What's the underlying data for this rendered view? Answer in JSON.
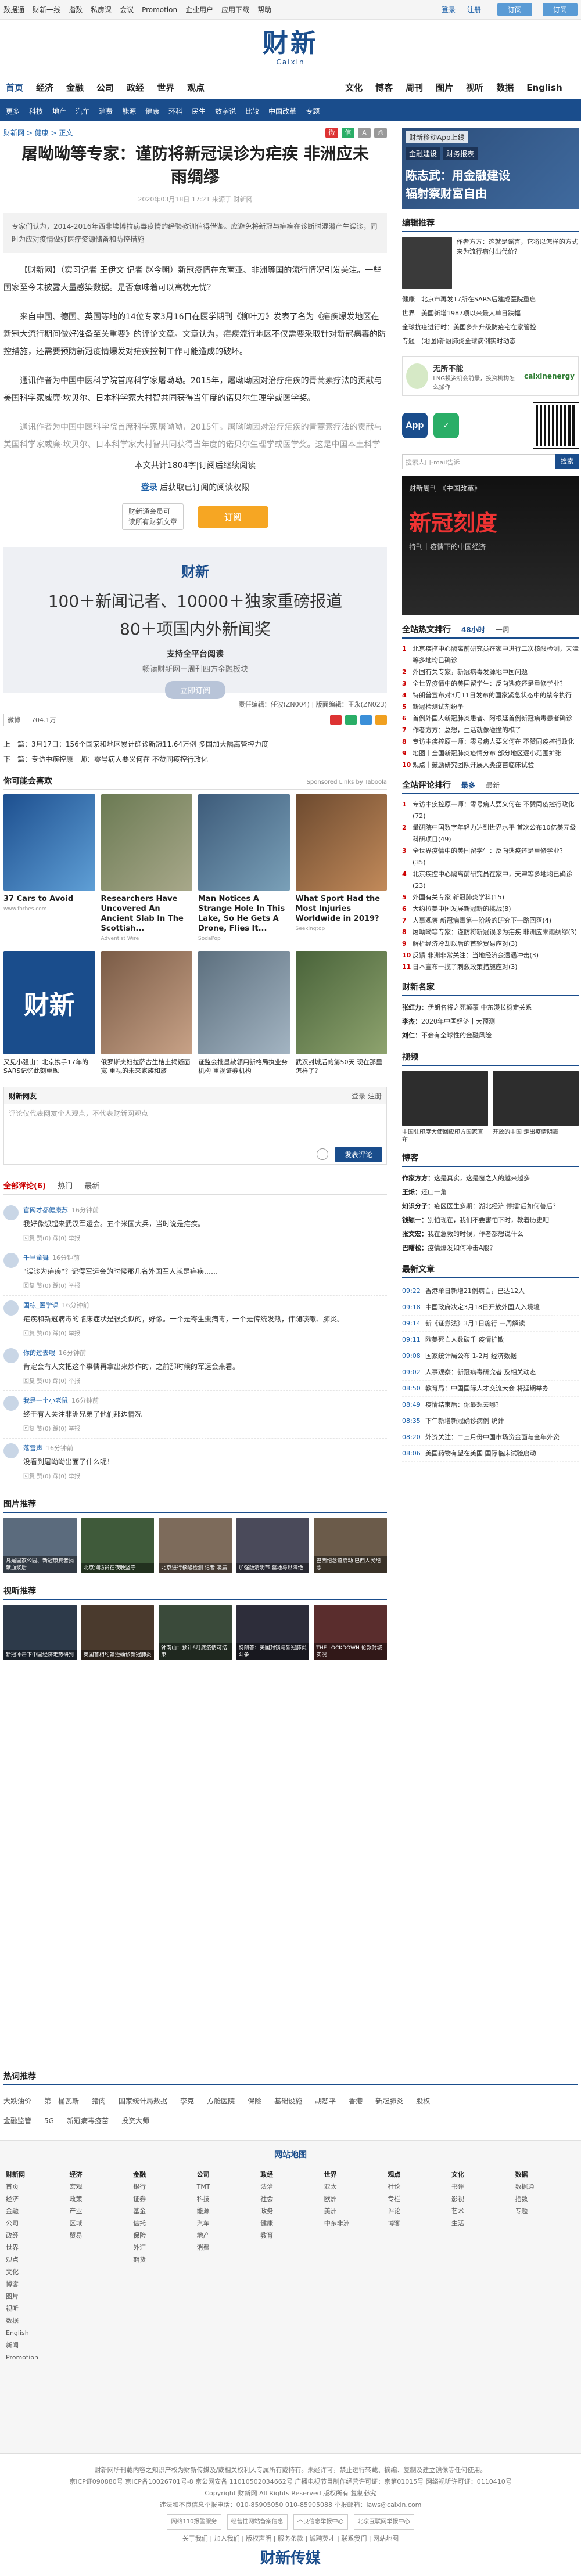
{
  "topbar": {
    "links": [
      "数据通",
      "财新一线",
      "指数",
      "私房课",
      "会议",
      "Promotion",
      "企业用户",
      "应用下载",
      "帮助"
    ],
    "login": "登录",
    "register": "注册",
    "sub_btn": "订阅",
    "sub_btn2": "订阅"
  },
  "header": {
    "logo": "财新",
    "logo_sub": "Caixin"
  },
  "mainnav": {
    "left": [
      "首页",
      "经济",
      "金融",
      "公司",
      "政经",
      "世界",
      "观点"
    ],
    "right": [
      "文化",
      "博客",
      "周刊",
      "图片",
      "视听",
      "数据",
      "English"
    ]
  },
  "subnav": {
    "items": [
      "更多",
      "科技",
      "地产",
      "汽车",
      "消费",
      "能源",
      "健康",
      "环科",
      "民生",
      "数字说",
      "比较",
      "中国改革",
      "专题"
    ],
    "more": "更多"
  },
  "article": {
    "breadcrumb": "财新网 > 健康 > 正文",
    "title": "屠呦呦等专家：谨防将新冠误诊为疟疾 非洲应未雨绸缪",
    "date": "2020年03月18日 17:21 来源于 财新网",
    "summary": "专家们认为，2014-2016年西非埃博拉病毒疫情的经验教训值得借鉴。应避免将新冠与疟疾在诊断时混淆产生误诊，同时为应对疫情做好医疗资源储备和防控措施",
    "p1": "【财新网】（实习记者 王伊文 记者 赵今朝）新冠疫情在东南亚、非洲等国的流行情况引发关注。一些国家至今未披露大量感染数据。是否意味着可以高枕无忧？",
    "p2": "来自中国、德国、英国等地的14位专家3月16日在医学期刊《柳叶刀》发表了名为《疟疾爆发地区在新冠大流行期间做好准备至关重要》的评论文章。文章认为，疟疾流行地区不仅需要采取针对新冠病毒的防控措施，还需要预防新冠疫情爆发对疟疾控制工作可能造成的破坏。",
    "p3": "通讯作者为中国中医科学院首席科学家屠呦呦。2015年，屠呦呦因对治疗疟疾的青蒿素疗法的贡献与美国科学家威廉·坎贝尔、日本科学家大村智共同获得当年度的诺贝尔生理学或医学奖。",
    "p4": "通讯作者为中国中医科学院首席科学家屠呦呦，2015年。屠呦呦因对治疗疟疾的青蒿素疗法的贡献与美国科学家威廉·坎贝尔、日本科学家大村智共同获得当年度的诺贝尔生理学或医学奖。这是中国本土科学家首次获得诺贝尔科学奖。",
    "wordcount": "本文共计1804字|订阅后继续阅读",
    "login_read_a": "登录",
    "login_read_b": " 后获取已订阅的阅读权限",
    "sub_note_1": "财新通会员可",
    "sub_note_2": "读所有财新文章",
    "sub_button": "订阅"
  },
  "promo": {
    "logo": "财新",
    "line1": "100＋新闻记者、10000＋独家重磅报道",
    "line2": "80＋项国内外新闻奖",
    "line3": "支持全平台阅读",
    "line4": "畅读财新网＋周刊四方金融板块",
    "line5": "立即订阅"
  },
  "meta": {
    "editors": "责任编辑：任波(ZN004) | 版面编辑：王永(ZN023)",
    "weibo": "微博",
    "weibo_count": "704.1万",
    "prev": "上一篇：3月17日：156个国家和地区累计确诊新冠11.64万例 多国加大隔离管控力度",
    "next": "下一篇：专访中疾控原一师：零号病人要义何在 不赞同疫控行政化"
  },
  "recommend": {
    "title": "你可能会喜欢",
    "sponsor": "Sponsored Links by Taboola",
    "row1": [
      {
        "cap": "37 Cars to Avoid",
        "src": "www.forbes.com"
      },
      {
        "cap": "Researchers Have Uncovered An Ancient Slab In The Scottish...",
        "src": "Adventist Wire"
      },
      {
        "cap": "Man Notices A Strange Hole In This Lake, So He Gets A Drone, Flies It...",
        "src": "SodaPop"
      },
      {
        "cap": "What Sport Had the Most Injuries Worldwide in 2019?",
        "src": "Seekingtop"
      }
    ],
    "row2": [
      {
        "cap": "又见小强山：北京携手17年的SARS记忆此刻重现"
      },
      {
        "cap": "俄罗斯夫妇拉萨古生桔土揭疑面宽 重视的未来家族和旅"
      },
      {
        "cap": "证监会批量赦领用新格局执业务机构 重视证券机构"
      },
      {
        "cap": "武汉封城后的第50天 现在那里怎样了？"
      }
    ]
  },
  "comments": {
    "box_title": "财新网友",
    "login": "登录  注册",
    "placeholder": "评论仅代表网友个人观点，不代表财新网观点",
    "submit": "发表评论",
    "tab_all": "全部评论(6)",
    "tab_hot": "热门",
    "tab_new": "最新",
    "items": [
      {
        "user": "官网才都健康苏",
        "time": "16分钟前",
        "text": "我好像想起来武汉军运会。五个米国大兵，当时说是疟疾。"
      },
      {
        "user": "千里童舞",
        "time": "16分钟前",
        "text": "\"误诊为疟疾\"？记得军运会的时候那几名外国军人就是疟疾……"
      },
      {
        "user": "国栋_医学课",
        "time": "16分钟前",
        "text": "疟疾和新冠病毒的临床症状是很类似的，好像。一个是寄生虫病毒，一个是传统发热，伴随咳嗽、肺炎。"
      },
      {
        "user": "你的过去喂",
        "time": "16分钟前",
        "text": "肯定会有人文把这个事情再拿出来炒作的，之前那时候的军运会来看。"
      },
      {
        "user": "我是一个小老鼠",
        "time": "16分钟前",
        "text": "终于有人关注非洲兄弟了他们那边情况"
      },
      {
        "user": "落雪声",
        "time": "16分钟前",
        "text": "没看到屠呦呦出面了什么呢！"
      }
    ],
    "ops": "回复  赞(0)  踩(0)  举报"
  },
  "pics": {
    "title": "图片推荐",
    "items": [
      "凡是国家公园、新冠康复者捐献血浆后",
      "北京消防员在夜晚坚守",
      "北京进行核酸检测 记者 凌晨",
      "加强版清明节 墓地与世隔绝",
      "巴西纪念馆启动 巴西人民纪念"
    ]
  },
  "videos": {
    "title": "视听推荐",
    "items": [
      "新冠冲击下中国经济走势研判",
      "英国首相约翰逊确诊新冠肺炎",
      "钟南山：预计6月底疫情可结束",
      "特朗普：美国封锁与新冠肺炎斗争",
      "THE LOCKDOWN 伦敦封城实况"
    ]
  },
  "side": {
    "ad1": {
      "label": "财新移动App上线",
      "tag1": "金融建设",
      "tag2": "财务报表",
      "h1": "陈志武：用金融建设",
      "h2": "辐射察财富自由"
    },
    "editor_title": "编辑推荐",
    "feature_txt": "作者方方：这就是谣言，它将以怎样的方式来为流行病付出代价？",
    "editor_list": [
      "健康｜北京市再发17所在SARS后建成医院重启",
      "世界｜美国新增1987项以来最大单日跌幅",
      "全球抗疫进行时：美国多州升级防疫宅在家管控",
      "专题｜(地图)新冠肺炎全球病例实时动态"
    ],
    "ad2": {
      "t1": "无所不能",
      "t2": "LNG投资机会前景，投资机构怎么操作",
      "brand": "caixinenergy"
    },
    "app_label": "App",
    "search_placeholder": "搜索人口-mail告诉",
    "search_btn": "搜索",
    "ad3": {
      "a1": "财新周刊 《中国改革》",
      "a2": "新冠刻度",
      "a3": "特刊｜疫情下的中国经济"
    },
    "rank": {
      "title": "全站热文排行",
      "tab1": "48小时",
      "tab2": "一周",
      "items": [
        "北京疾控中心隔离前研究员在家中进行二次核酸检测，天津等多地均已确诊",
        "外国有关专家，新冠病毒发源地中国问题",
        "全世界疫情中的美国留学生：反向逃疫还是重修学业？",
        "特朗普宣布对3月11日发布的国家紧急状态中的禁令执行",
        "新冠检测试剂纷争",
        "首例外国人新冠肺炎患者、阿根廷首例新冠病毒患者确诊",
        "作者方方：总想，生活就像碰撞的棋子",
        "专访中疾控原一师：零号病人要义何在 不赞同疫控行政化",
        "地图｜全国新冠肺炎疫情分布 部分地区逐小范围扩张",
        "观点｜鼓励研究团队开展人类疫苗临床试验"
      ]
    },
    "comment_rank": {
      "title": "全站评论排行",
      "tab1": "最多",
      "tab2": "最新",
      "items": [
        "专访中疾控原一师：零号病人要义何在 不赞同疫控行政化(72)",
        "量研院中国数字年轻力达到世界水平 首次公布10亿美元级科研项目(49)",
        "全世界疫情中的美国留学生：反向逃疫还是重修学业？(35)",
        "北京疾控中心隔离前研究员在家中，天津等多地均已确诊(23)",
        "外国有关专家 新冠肺炎学科(15)",
        "大约拉美中国发展新冠新的挑战(8)",
        "人事观察 新冠病毒第一阶段的研究下一路回落(4)",
        "屠呦呦等专家：谨防将新冠误诊为疟疾 非洲应未雨绸缪(3)",
        "解析经济冷却以后的首轮贸易应对(3)",
        "反馈 非洲非常关注：当地经济会遭遇冲击(3)",
        "日本宣布一揽子刺激政策措施应对(3)"
      ]
    },
    "authors": {
      "title": "财新名家",
      "items": [
        {
          "n": "张红力",
          "t": "伊朗名将之死颠覆 中东漫长稳定关系"
        },
        {
          "n": "李杰",
          "t": "2020年中国经济十大预测"
        },
        {
          "n": "刘仁",
          "t": "不会有全球性的金融风险"
        }
      ]
    },
    "video": {
      "title": "视频",
      "items": [
        "中国驻印度大使回应印方国家宣布",
        "开放的中国 走出疫情阴霾"
      ]
    },
    "blog": {
      "title": "博客",
      "items": [
        {
          "n": "作家方方：",
          "t": "这是真实，这是窗之人的越来越多"
        },
        {
          "n": "王烁：",
          "t": "还山一角"
        },
        {
          "n": "知识分子：",
          "t": "疫区医生多期：湖北经济'停摆'后如何善后？"
        },
        {
          "n": "钱颖一：",
          "t": "别怕现在，我们不要害怕下时，教着历史吧"
        },
        {
          "n": "张文宏：",
          "t": "我在急救的时候，作者都想说什么"
        },
        {
          "n": "巴曙松：",
          "t": "疫情爆发如何冲击A股？"
        }
      ]
    },
    "latest": {
      "title": "最新文章",
      "items": [
        {
          "tm": "09:22",
          "t": "香港单日新增21例病亡，已达12人"
        },
        {
          "tm": "09:18",
          "t": "中国政府决定3月18日开放外国人入境境"
        },
        {
          "tm": "09:14",
          "t": "新《证券法》3月1日施行 一周解读"
        },
        {
          "tm": "09:11",
          "t": "欧美死亡人数破千 疫情扩散"
        },
        {
          "tm": "09:08",
          "t": "国家统计局公布 1-2月 经济数据"
        },
        {
          "tm": "09:02",
          "t": "人事观察：新冠病毒研究者 及相关动态"
        },
        {
          "tm": "08:50",
          "t": "教育局：中国国际人才交流大会 将延期举办"
        },
        {
          "tm": "08:49",
          "t": "疫情结束后：你最想去哪？"
        },
        {
          "tm": "08:35",
          "t": "下午新增新冠确诊病例 统计"
        },
        {
          "tm": "08:20",
          "t": "外资关注：二三月份中国市场资金面与全年外资"
        },
        {
          "tm": "08:06",
          "t": "美国药物有望在美国 国际临床试验启动"
        }
      ]
    }
  },
  "bottom": {
    "hot_title": "热词推荐",
    "hot_row1": [
      "大跌油价",
      "第一桶瓦斯",
      "猪肉",
      "国家统计局数据",
      "李克",
      "方舱医院",
      "保险",
      "基础设施",
      "胡恕平",
      "香港",
      "新冠肺炎",
      "股权"
    ],
    "hot_row2": [
      "金融监管",
      "5G",
      "新冠病毒疫苗",
      "投资大师"
    ],
    "sitemap_title": "网站地图",
    "cols": [
      {
        "hd": "财新网",
        "items": [
          "首页",
          "经济",
          "金融",
          "公司",
          "政经",
          "世界",
          "观点",
          "文化",
          "博客",
          "图片",
          "视听",
          "数据",
          "English",
          "新闻",
          "Promotion"
        ]
      },
      {
        "hd": "经济",
        "items": [
          "宏观",
          "政策",
          "产业",
          "区域",
          "贸易"
        ]
      },
      {
        "hd": "金融",
        "items": [
          "银行",
          "证券",
          "基金",
          "信托",
          "保险",
          "外汇",
          "期货"
        ]
      },
      {
        "hd": "公司",
        "items": [
          "TMT",
          "科技",
          "能源",
          "汽车",
          "地产",
          "消费"
        ]
      },
      {
        "hd": "政经",
        "items": [
          "法治",
          "社会",
          "政务",
          "健康",
          "教育"
        ]
      },
      {
        "hd": "世界",
        "items": [
          "亚太",
          "欧洲",
          "美洲",
          "中东非洲"
        ]
      },
      {
        "hd": "观点",
        "items": [
          "社论",
          "专栏",
          "评论",
          "博客"
        ]
      },
      {
        "hd": "文化",
        "items": [
          "书评",
          "影视",
          "艺术",
          "生活"
        ]
      },
      {
        "hd": "数据",
        "items": [
          "数据通",
          "指数",
          "专题"
        ]
      }
    ],
    "footer1": "财新网所刊载内容之知识产权为财新传媒及/或相关权利人专属所有或持有。未经许可，禁止进行转载、摘编、复制及建立镜像等任何使用。",
    "footer2": "京ICP证090880号  京ICP备10026701号-8  京公网安备 11010502034662号  广播电视节目制作经营许可证：京第01015号  网络视听许可证：0110410号",
    "footer3": "Copyright 财新网 All Rights Reserved 版权所有 复制必究",
    "footer4": "违法和不良信息举报电话：010-85905050  010-85905088  举报邮箱：laws@caixin.com",
    "badges": [
      "网络110报警服务",
      "经营性网站备案信息",
      "不良信息举报中心",
      "北京互联网举报中心"
    ],
    "footer5": "关于我们 | 加入我们 | 版权声明 | 服务条款 | 诚聘英才 | 联系我们 | 网站地图",
    "flogo": "财新传媒"
  }
}
